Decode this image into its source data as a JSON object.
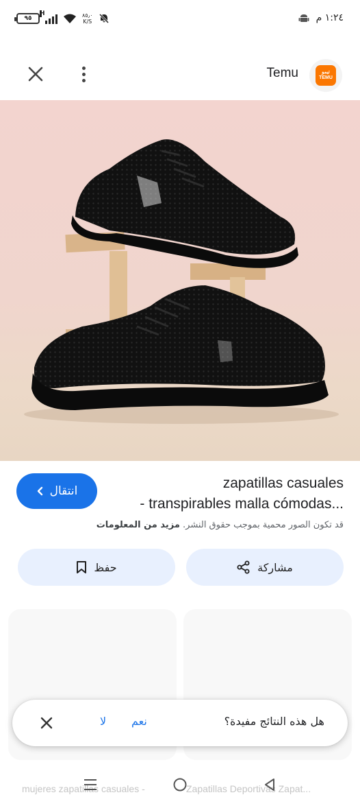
{
  "status_bar": {
    "battery": "٩٥",
    "network": "H",
    "speed_value": "٨٥٫٠",
    "speed_unit": "K/S",
    "time": "١:٢٤ م"
  },
  "header": {
    "site_name": "Temu",
    "logo_text_top": "تيمو",
    "logo_text_bottom": "TEMU",
    "icons": [
      "close-icon",
      "more-vert-icon"
    ]
  },
  "product": {
    "title_line1": "zapatillas casuales",
    "title_line2": "- transpirables malla cómodas...",
    "copyright_text": "قد تكون الصور محمية بموجب حقوق النشر.",
    "learn_more": "مزيد من المعلومات",
    "visit_label": "انتقال",
    "save_label": "حفظ",
    "share_label": "مشاركة"
  },
  "feedback": {
    "question": "هل هذه النتائج مفيدة؟",
    "yes_label": "نعم",
    "no_label": "لا"
  },
  "related": {
    "left_caption": "mujeres zapatillas casuales -",
    "right_caption": "Zapatillas Deportivas Zapat..."
  },
  "colors": {
    "accent": "#1a73e8",
    "button_tint": "#e8f0fe",
    "temu_orange": "#fb7701"
  }
}
